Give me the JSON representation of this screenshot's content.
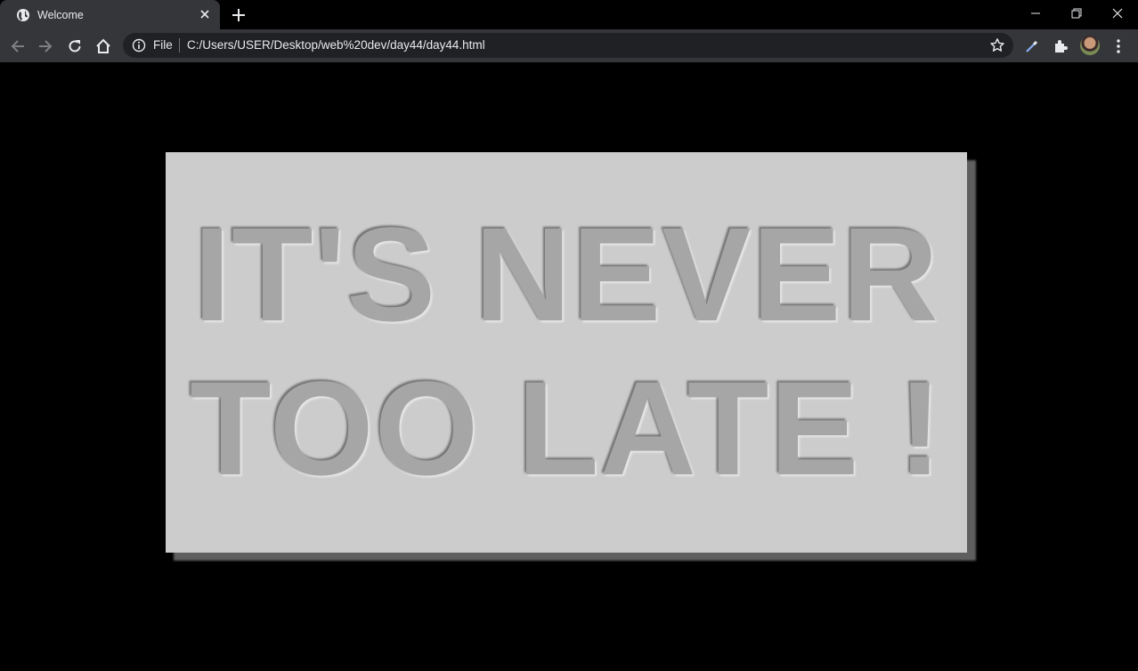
{
  "browser": {
    "tab": {
      "title": "Welcome"
    },
    "omnibox": {
      "scheme_label": "File",
      "url": "C:/Users/USER/Desktop/web%20dev/day44/day44.html"
    },
    "icons": {
      "favicon": "globe-icon",
      "back": "arrow-left-icon",
      "forward": "arrow-right-icon",
      "reload": "reload-icon",
      "home": "home-icon",
      "info": "info-icon",
      "bookmark": "star-icon",
      "eyedropper": "eyedropper-icon",
      "extensions": "puzzle-icon",
      "menu": "kebab-menu-icon"
    }
  },
  "page": {
    "background": "#000000",
    "card_color": "#cccccc",
    "text_color": "#a6a6a6",
    "lines": [
      "IT'S NEVER",
      "TOO LATE !"
    ]
  }
}
